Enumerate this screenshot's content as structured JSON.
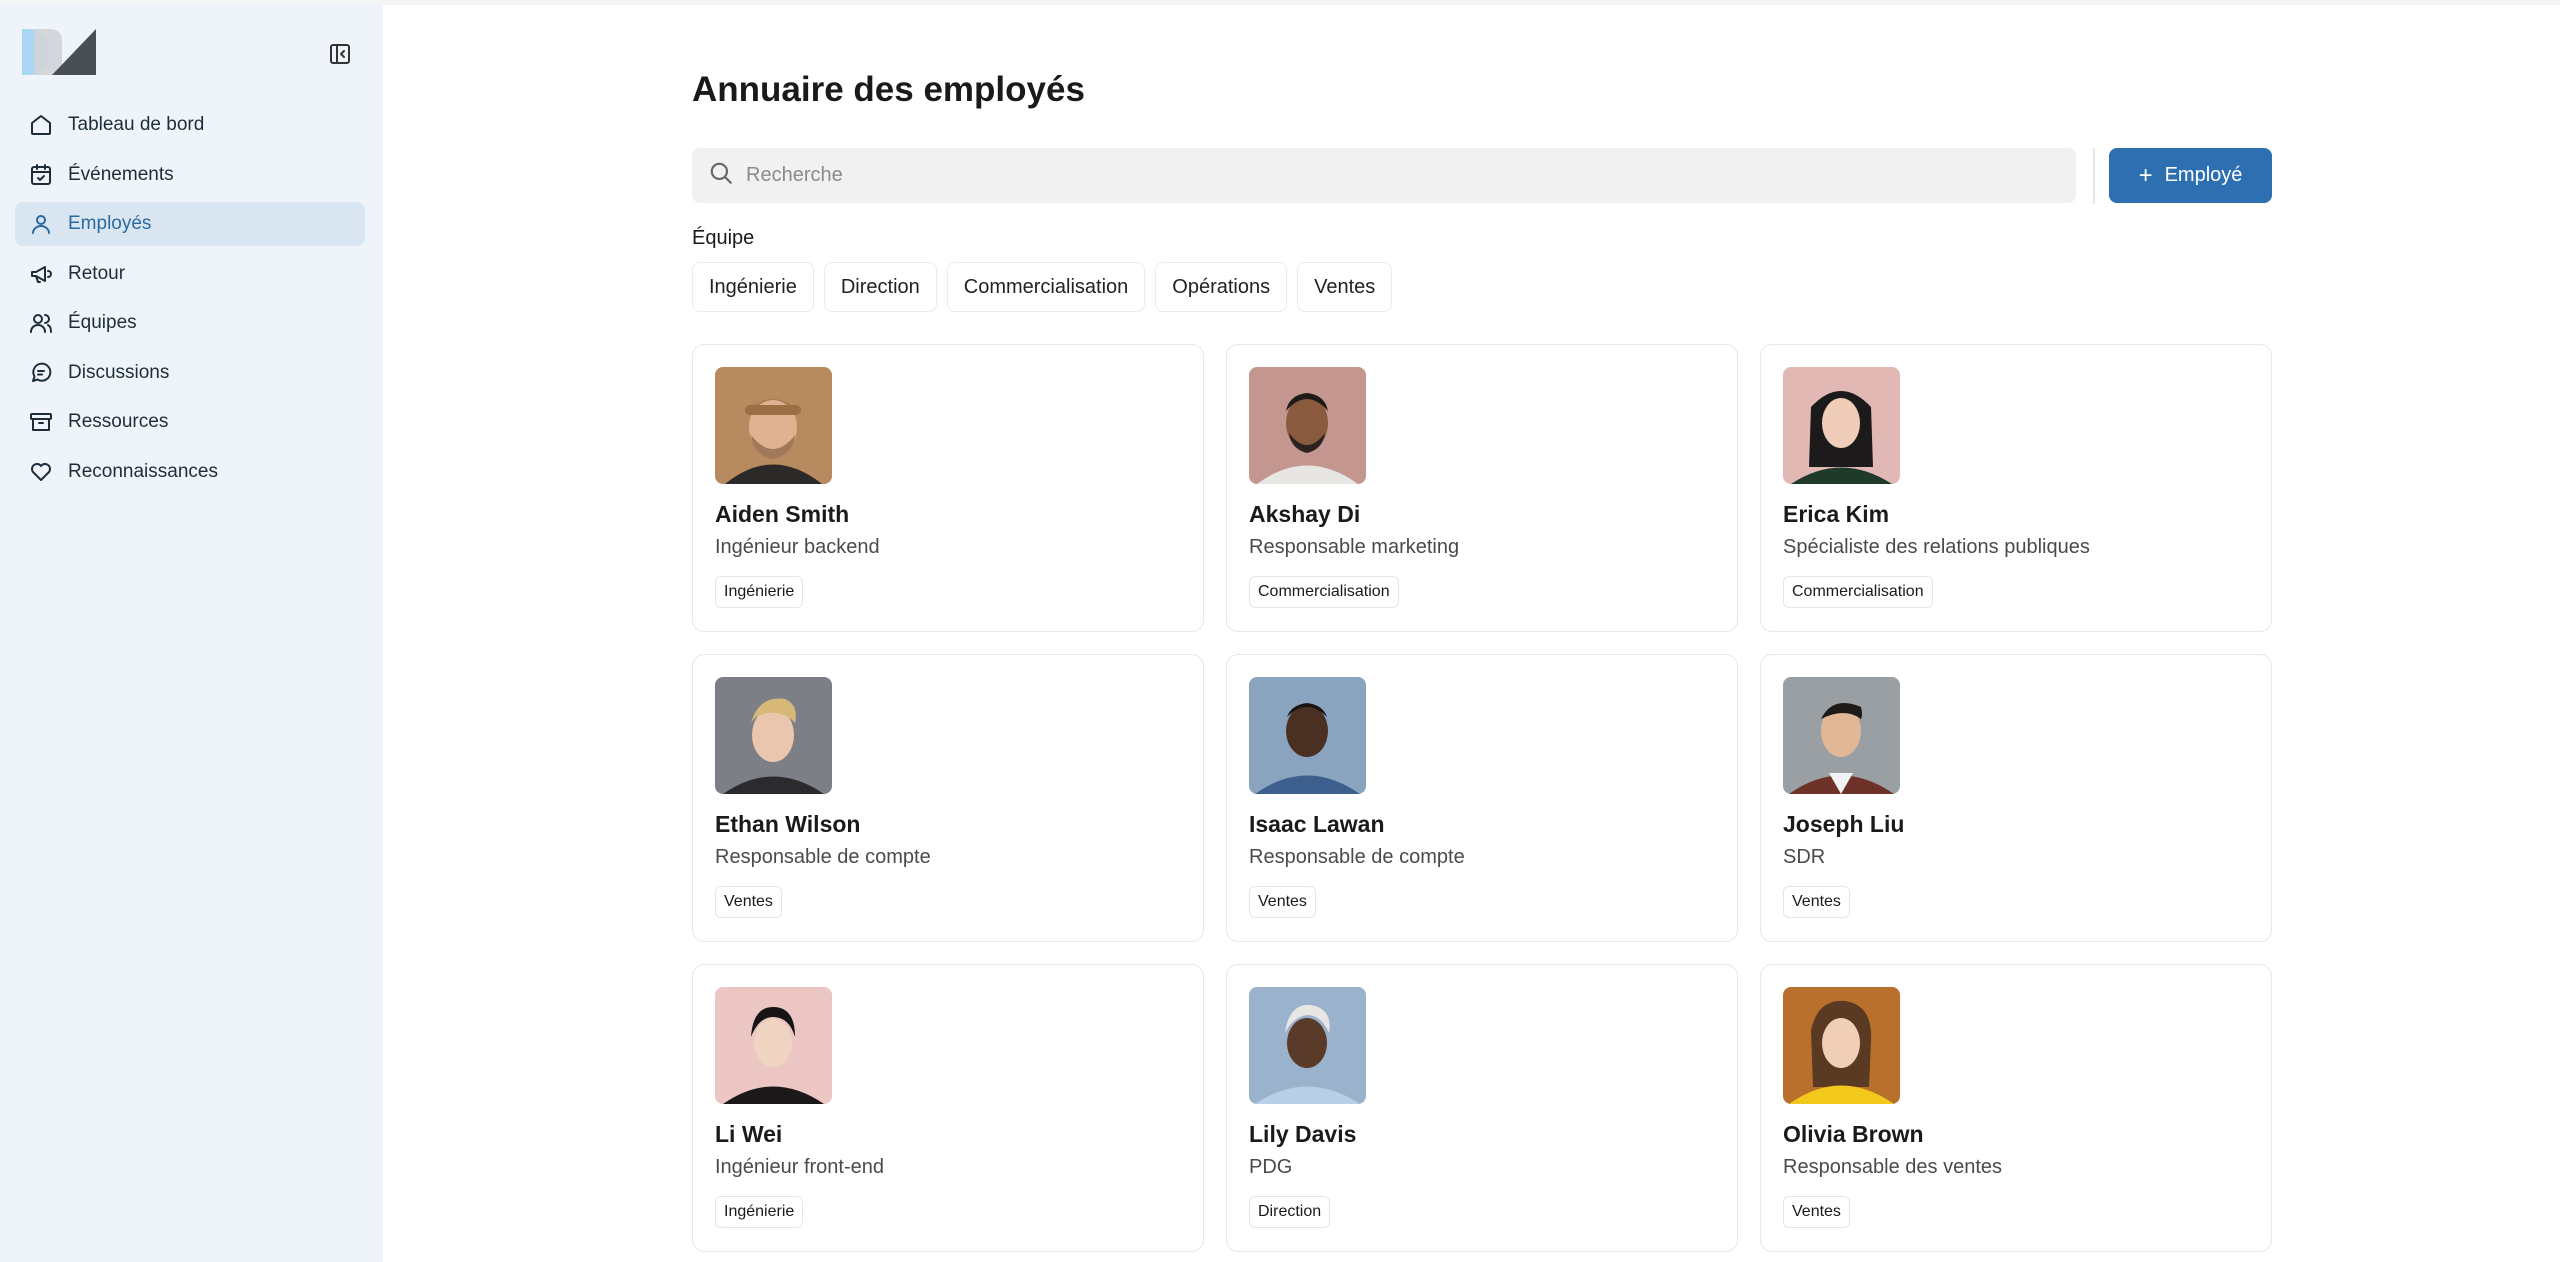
{
  "sidebar": {
    "items": [
      {
        "label": "Tableau de bord",
        "icon": "home-icon"
      },
      {
        "label": "Événements",
        "icon": "calendar-check-icon"
      },
      {
        "label": "Employés",
        "icon": "user-icon",
        "active": true
      },
      {
        "label": "Retour",
        "icon": "megaphone-icon"
      },
      {
        "label": "Équipes",
        "icon": "users-icon"
      },
      {
        "label": "Discussions",
        "icon": "message-circle-icon"
      },
      {
        "label": "Ressources",
        "icon": "archive-icon"
      },
      {
        "label": "Reconnaissances",
        "icon": "heart-icon"
      }
    ]
  },
  "main": {
    "title": "Annuaire des employés",
    "search": {
      "placeholder": "Recherche",
      "value": ""
    },
    "add_button": "Employé",
    "filter_label": "Équipe",
    "filters": [
      "Ingénierie",
      "Direction",
      "Commercialisation",
      "Opérations",
      "Ventes"
    ],
    "employees": [
      {
        "name": "Aiden Smith",
        "role": "Ingénieur backend",
        "team": "Ingénierie"
      },
      {
        "name": "Akshay Di",
        "role": "Responsable marketing",
        "team": "Commercialisation"
      },
      {
        "name": "Erica Kim",
        "role": "Spécialiste des relations publiques",
        "team": "Commercialisation"
      },
      {
        "name": "Ethan Wilson",
        "role": "Responsable de compte",
        "team": "Ventes"
      },
      {
        "name": "Isaac Lawan",
        "role": "Responsable de compte",
        "team": "Ventes"
      },
      {
        "name": "Joseph Liu",
        "role": "SDR",
        "team": "Ventes"
      },
      {
        "name": "Li Wei",
        "role": "Ingénieur front-end",
        "team": "Ingénierie"
      },
      {
        "name": "Lily Davis",
        "role": "PDG",
        "team": "Direction"
      },
      {
        "name": "Olivia Brown",
        "role": "Responsable des ventes",
        "team": "Ventes"
      }
    ]
  },
  "colors": {
    "sidebar_bg": "#eef4f9",
    "nav_active_bg": "#d9e6f1",
    "nav_active_text": "#2a6aa0",
    "accent": "#2d6fb0"
  }
}
